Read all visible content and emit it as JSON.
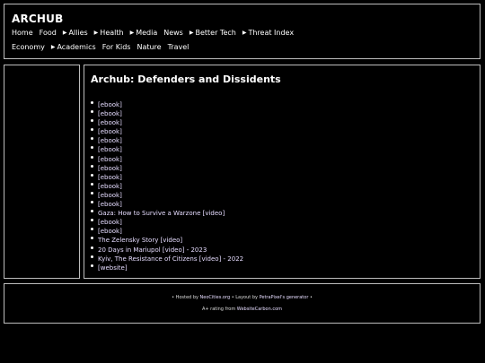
{
  "site": {
    "title": "ARCHUB"
  },
  "nav": {
    "row1": [
      {
        "label": "Home",
        "arrow": false
      },
      {
        "label": "Food",
        "arrow": false
      },
      {
        "label": "Allies",
        "arrow": true
      },
      {
        "label": "Health",
        "arrow": true
      },
      {
        "label": "Media",
        "arrow": true
      },
      {
        "label": "News",
        "arrow": false
      },
      {
        "label": "Better Tech",
        "arrow": true
      },
      {
        "label": "Threat Index",
        "arrow": true
      }
    ],
    "row2": [
      {
        "label": "Economy",
        "arrow": false
      },
      {
        "label": "Academics",
        "arrow": true
      },
      {
        "label": "For Kids",
        "arrow": false
      },
      {
        "label": "Nature",
        "arrow": false
      },
      {
        "label": "Travel",
        "arrow": false
      }
    ],
    "arrow_glyph": "▶"
  },
  "main": {
    "title": "Archub: Defenders and Dissidents",
    "links": [
      "[ebook]",
      "[ebook]",
      "[ebook]",
      "[ebook]",
      "[ebook]",
      "[ebook]",
      "[ebook]",
      "[ebook]",
      "[ebook]",
      "[ebook]",
      "[ebook]",
      "[ebook]",
      "Gaza: How to Survive a Warzone [video]",
      "[ebook]",
      "[ebook]",
      "The Zelensky Story [video]",
      "20 Days in Mariupol [video] - 2023",
      "Kyiv, The Resistance of Citizens [video] - 2022",
      "[website]"
    ]
  },
  "footer": {
    "line1_prefix": "• Hosted by ",
    "host_link": "NeoCities.org",
    "line1_mid": " • Layout by ",
    "layout_link": "PetraPixel's generator",
    "line1_suffix": " •",
    "line2_prefix": "A+ rating from ",
    "rating_link": "WebsiteCarbon.com"
  }
}
